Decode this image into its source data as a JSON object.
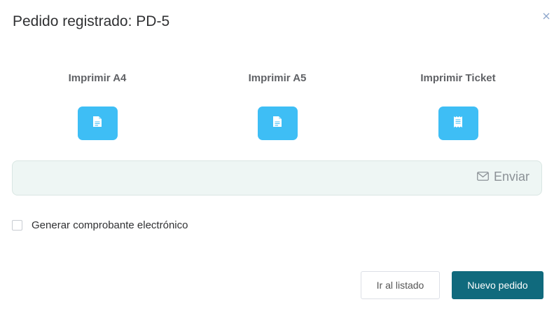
{
  "dialog": {
    "title": "Pedido registrado: PD-5",
    "close_icon": "close-icon"
  },
  "print_options": [
    {
      "label": "Imprimir A4",
      "icon": "document-icon"
    },
    {
      "label": "Imprimir A5",
      "icon": "document-icon"
    },
    {
      "label": "Imprimir Ticket",
      "icon": "receipt-icon"
    }
  ],
  "send": {
    "label": "Enviar",
    "icon": "envelope-icon"
  },
  "electronic_receipt": {
    "label": "Generar comprobante electrónico",
    "checked": false
  },
  "footer": {
    "secondary_label": "Ir al listado",
    "primary_label": "Nuevo pedido"
  },
  "colors": {
    "print_button": "#3ebef5",
    "primary_button": "#106a7d",
    "send_bar_bg": "#eef6f4"
  }
}
